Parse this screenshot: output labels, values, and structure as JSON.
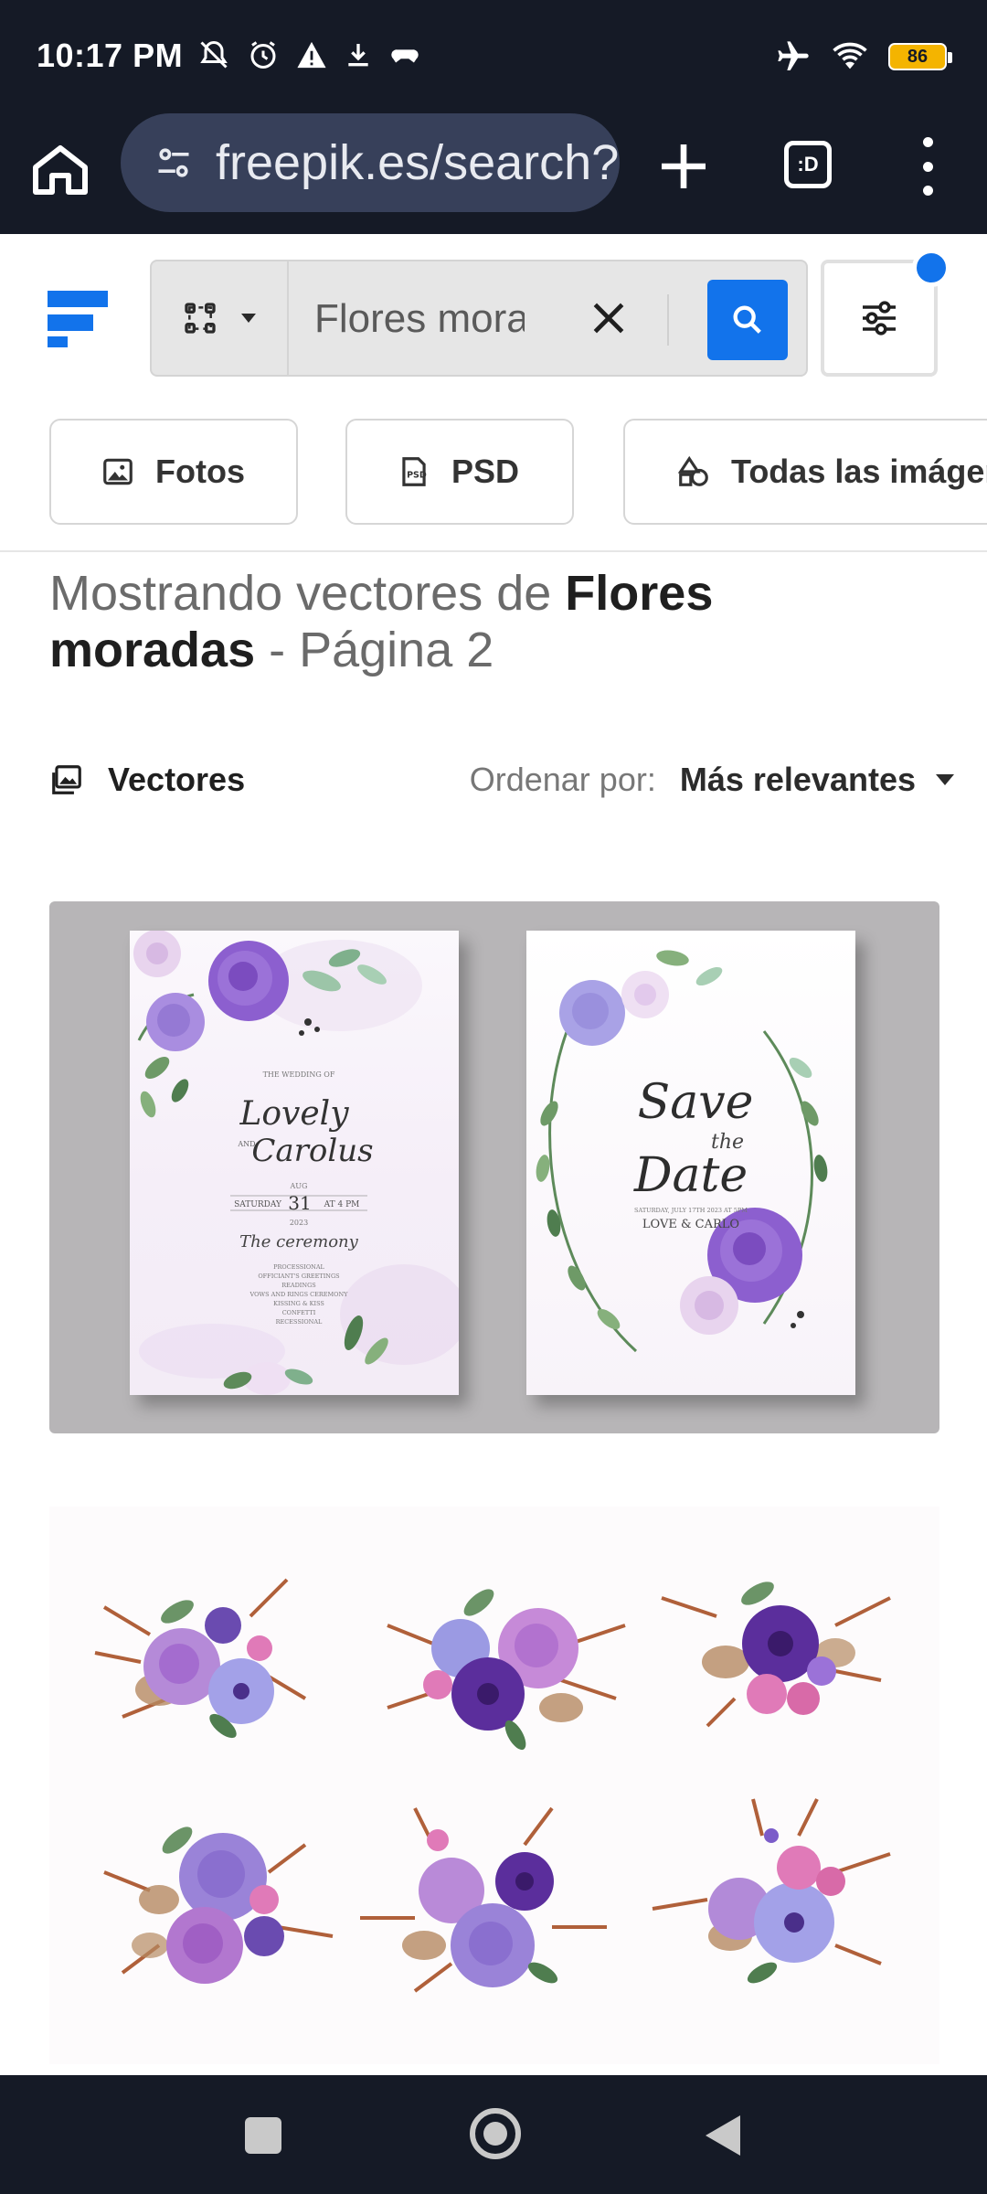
{
  "status_bar": {
    "time": "10:17 PM",
    "battery": "86"
  },
  "browser": {
    "url": "freepik.es/search?",
    "tabs_label": ":D"
  },
  "search": {
    "query": "Flores moradas"
  },
  "categories": [
    {
      "label": "Fotos",
      "icon": "image-icon"
    },
    {
      "label": "PSD",
      "icon": "psd-icon"
    },
    {
      "label": "Todas las imágenes",
      "icon": "shapes-icon"
    }
  ],
  "heading": {
    "prefix": "Mostrando vectores de ",
    "term_part1": "Flores",
    "term_part2": "moradas",
    "suffix": " - Página 2"
  },
  "filter_row": {
    "type_label": "Vectores",
    "sort_label": "Ordenar por:",
    "sort_value": "Más relevantes"
  },
  "results": [
    {
      "kind": "wedding-invitation-cards",
      "card_left": {
        "small_header": "THE WEDDING OF",
        "name1": "Lovely",
        "and": "AND",
        "name2": "Carolus",
        "month": "AUG",
        "day_label": "SATURDAY",
        "day": "31",
        "time": "AT 4 PM",
        "year": "2023",
        "ceremony": "The ceremony",
        "program": [
          "PROCESSIONAL",
          "OFFICIANT'S GREETINGS",
          "READINGS",
          "VOWS AND RINGS CEREMONY",
          "KISSING & KISS",
          "CONFETTI",
          "RECESSIONAL"
        ]
      },
      "card_right": {
        "line1": "Save",
        "line2": "the",
        "line3": "Date",
        "date_line": "SATURDAY, JULY 17TH 2023 AT 5PM",
        "names": "LOVE & CARLO"
      }
    },
    {
      "kind": "watercolor-bouquet-set"
    }
  ],
  "colors": {
    "system_bar": "#151a26",
    "url_bar": "#37405a",
    "accent_blue": "#1273eb",
    "card_bg_gray": "#b7b5b7",
    "purple": "#8b5cc9",
    "pink": "#d880c0"
  }
}
